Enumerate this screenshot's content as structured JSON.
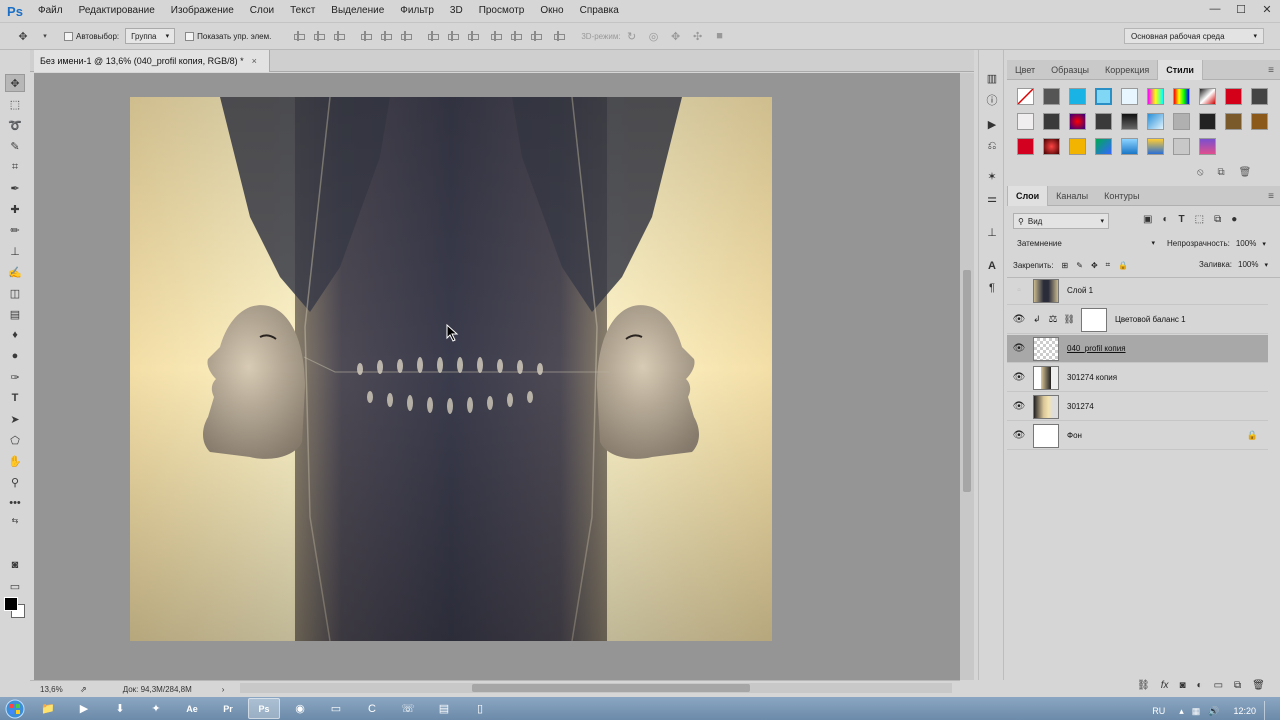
{
  "app": {
    "logo": "Ps",
    "menu": [
      "Файл",
      "Редактирование",
      "Изображение",
      "Слои",
      "Текст",
      "Выделение",
      "Фильтр",
      "3D",
      "Просмотр",
      "Окно",
      "Справка"
    ],
    "window_controls": [
      "—",
      "☐",
      "✕"
    ]
  },
  "options": {
    "autoselect_label": "Автовыбор:",
    "autoselect_value": "Группа",
    "show_transform_label": "Показать упр. элем.",
    "mode3d_label": "3D-режим:",
    "workspace": "Основная рабочая среда"
  },
  "document": {
    "tab_title": "Без имени-1 @ 13,6% (040_profil копия, RGB/8) *",
    "close": "×"
  },
  "status": {
    "zoom": "13,6%",
    "doc_info": "Док: 94,3M/284,8M"
  },
  "panel_top": {
    "tabs": [
      "Цвет",
      "Образцы",
      "Коррекция",
      "Стили"
    ],
    "active_tab": "Стили"
  },
  "layers_panel": {
    "tabs": [
      "Слои",
      "Каналы",
      "Контуры"
    ],
    "active_tab": "Слои",
    "filter_kind": "Вид",
    "blend_mode": "Затемнение",
    "opacity_label": "Непрозрачность:",
    "opacity_value": "100%",
    "lock_label": "Закрепить:",
    "fill_label": "Заливка:",
    "fill_value": "100%",
    "layers": [
      {
        "name": "Слой 1",
        "visible": false,
        "selected": false,
        "kind": "photo"
      },
      {
        "name": "Цветовой баланс 1",
        "visible": true,
        "selected": false,
        "kind": "adjustment"
      },
      {
        "name": "040_profil копия",
        "visible": true,
        "selected": true,
        "kind": "transparent"
      },
      {
        "name": "301274 копия",
        "visible": true,
        "selected": false,
        "kind": "face"
      },
      {
        "name": "301274",
        "visible": true,
        "selected": false,
        "kind": "face"
      },
      {
        "name": "Фон",
        "visible": true,
        "selected": false,
        "kind": "white",
        "locked": true
      }
    ]
  },
  "taskbar": {
    "lang": "RU",
    "time": "12:20"
  },
  "colors": {
    "fg": "#000000",
    "bg": "#ffffff",
    "accent": "#1b6fc6"
  }
}
